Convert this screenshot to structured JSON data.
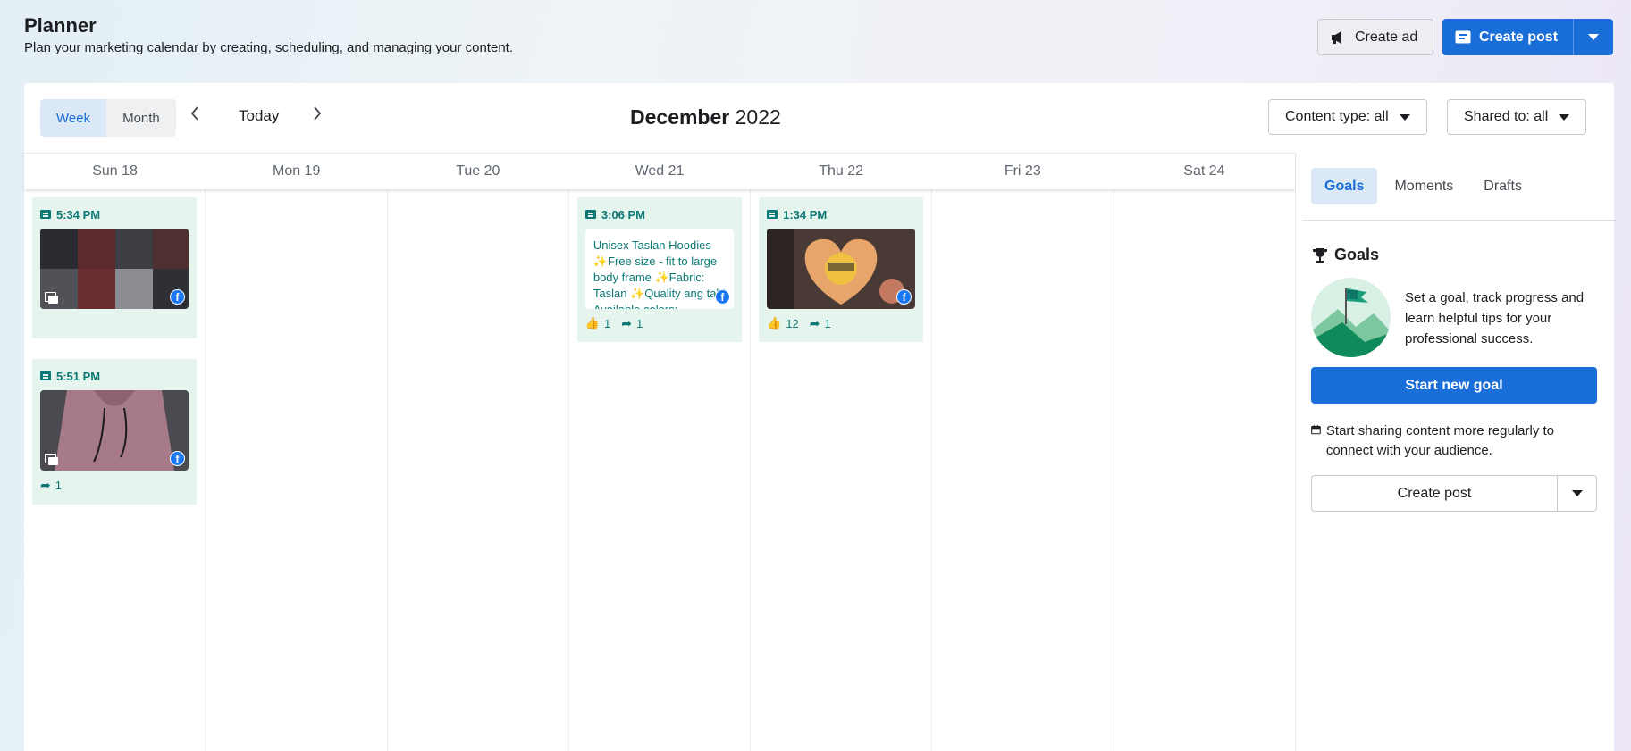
{
  "header": {
    "title": "Planner",
    "subtitle": "Plan your marketing calendar by creating, scheduling, and managing your content.",
    "create_ad_label": "Create ad",
    "create_post_label": "Create post"
  },
  "toolbar": {
    "view_week": "Week",
    "view_month": "Month",
    "active_view": "Week",
    "today_label": "Today",
    "month_name": "December",
    "year": "2022",
    "content_type_filter": "Content type: all",
    "shared_to_filter": "Shared to: all"
  },
  "calendar": {
    "days": [
      "Sun 18",
      "Mon 19",
      "Tue 20",
      "Wed 21",
      "Thu 22",
      "Fri 23",
      "Sat 24"
    ],
    "posts": {
      "sun_1": {
        "time": "5:34 PM"
      },
      "sun_2": {
        "time": "5:51 PM",
        "shares": "1"
      },
      "wed_1": {
        "time": "3:06 PM",
        "text": "Unisex Taslan Hoodies ✨Free size - fit to large body frame ✨Fabric: Taslan ✨Quality ang tahi Available colors:",
        "likes": "1",
        "shares": "1"
      },
      "thu_1": {
        "time": "1:34 PM",
        "likes": "12",
        "shares": "1"
      }
    }
  },
  "sidebar": {
    "tabs": [
      "Goals",
      "Moments",
      "Drafts"
    ],
    "active_tab": "Goals",
    "goals_heading": "Goals",
    "goal_description": "Set a goal, track progress and learn helpful tips for your professional success.",
    "start_goal_label": "Start new goal",
    "tip_text": "Start sharing content more regularly to connect with your audience.",
    "create_post_label": "Create post"
  },
  "colors": {
    "accent": "#1a6ed8",
    "post_card_bg": "#e6f4ee",
    "post_text": "#0b7a76",
    "facebook": "#1877f2"
  }
}
